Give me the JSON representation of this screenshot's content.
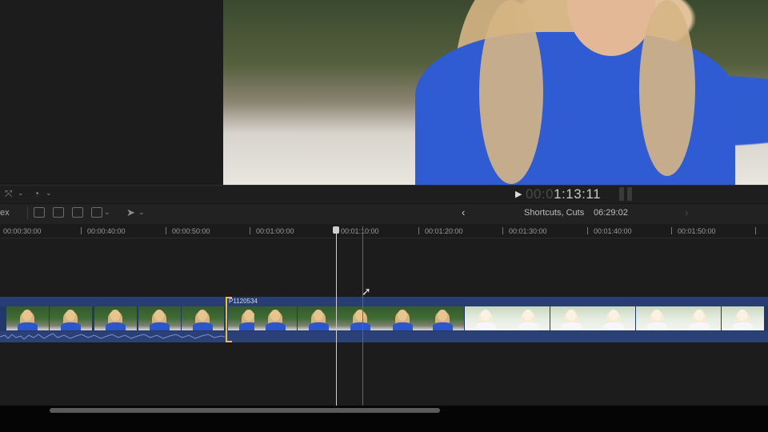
{
  "viewer": {
    "timecode_dim": "00:0",
    "timecode_lit": "1:13:11",
    "play_icon": "play-icon"
  },
  "viewer_toolbar": {
    "icons": [
      "transform-icon",
      "chevron-down-icon",
      "speed-gauge-icon",
      "chevron-down-icon"
    ]
  },
  "timeline_toolbar": {
    "partial_label": "ex",
    "icons": [
      "connect-clip-icon",
      "insert-clip-icon",
      "append-clip-icon",
      "overwrite-clip-icon",
      "chevron-down-icon",
      "select-arrow-icon",
      "chevron-down-icon"
    ],
    "back_icon": "chevron-left-icon",
    "forward_icon": "chevron-right-icon",
    "project_title": "Shortcuts, Cuts",
    "project_duration": "06:29:02"
  },
  "ruler": {
    "labels": [
      "00:00:30:00",
      "00:00:40:00",
      "00:00:50:00",
      "00:01:00:00",
      "00:01:10:00",
      "00:01:20:00",
      "00:01:30:00",
      "00:01:40:00",
      "00:01:50:00"
    ]
  },
  "clip": {
    "name": "P1120534"
  },
  "colors": {
    "clip_blue": "#23386a",
    "selection_yellow": "#e8c233",
    "skimmer_red": "#b8462c",
    "playhead": "#cfcfcf"
  }
}
